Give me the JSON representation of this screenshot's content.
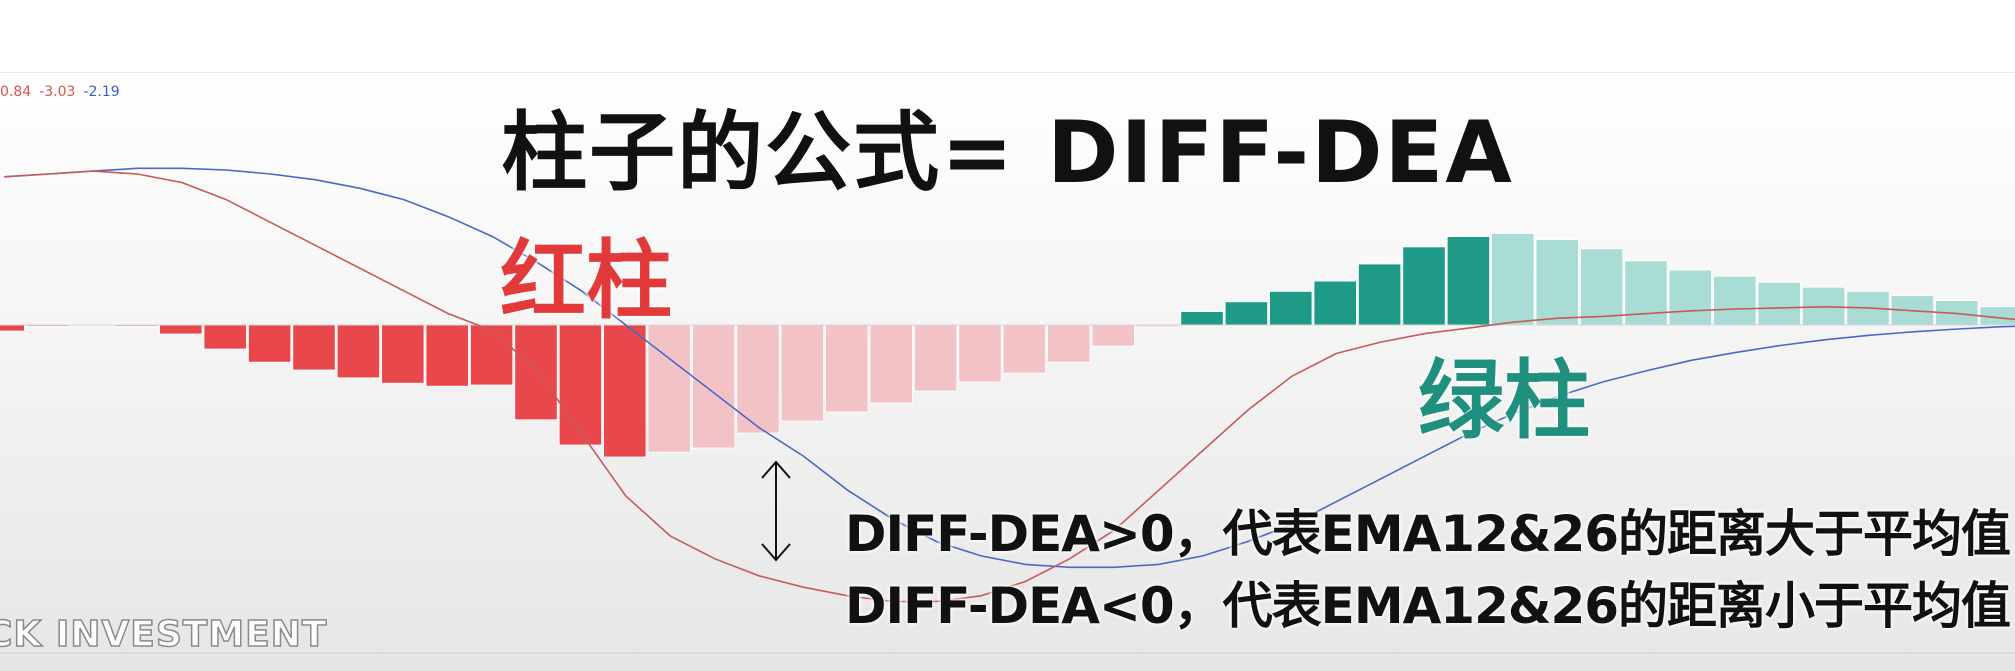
{
  "indicator_values": {
    "v1": "0.84",
    "v2": "-3.03",
    "v3": "-2.19"
  },
  "title": "柱子的公式= DIFF-DEA",
  "labels": {
    "red": "红柱",
    "green": "绿柱"
  },
  "explanations": {
    "positive": "DIFF-DEA>0，代表EMA12&26的距离大于平均值",
    "negative": "DIFF-DEA<0，代表EMA12&26的距离小于平均值"
  },
  "watermark": "CK INVESTMENT",
  "colors": {
    "red_solid": "#e8474b",
    "red_faded": "#f2c2c7",
    "green_solid": "#1e9a86",
    "green_faded": "#a9dcd4",
    "diff_line": "#c85a5a",
    "dea_line": "#4a68c8"
  },
  "chart_data": {
    "type": "bar",
    "ylim": [
      -2.2,
      1.6
    ],
    "histogram": [
      -0.1,
      -0.02,
      0,
      -0.02,
      -0.15,
      -0.4,
      -0.62,
      -0.75,
      -0.88,
      -0.97,
      -1.02,
      -1.0,
      -1.58,
      -2.0,
      -2.2,
      -2.12,
      -2.05,
      -1.8,
      -1.6,
      -1.45,
      -1.3,
      -1.1,
      -0.95,
      -0.8,
      -0.62,
      -0.35,
      -0.03,
      0.22,
      0.38,
      0.55,
      0.72,
      1.0,
      1.28,
      1.45,
      1.5,
      1.4,
      1.25,
      1.05,
      0.9,
      0.8,
      0.7,
      0.62,
      0.55,
      0.48,
      0.4,
      0.3,
      0.2,
      0.1
    ],
    "solid_red_end": 14,
    "solid_green_start": 26,
    "solid_green_end": 33,
    "diff": [
      2.6,
      2.65,
      2.7,
      2.65,
      2.5,
      2.2,
      1.8,
      1.4,
      1.0,
      0.6,
      0.2,
      -0.1,
      -0.8,
      -1.9,
      -3.0,
      -3.7,
      -4.1,
      -4.4,
      -4.6,
      -4.75,
      -4.85,
      -4.85,
      -4.75,
      -4.5,
      -4.1,
      -3.6,
      -2.9,
      -2.2,
      -1.5,
      -0.9,
      -0.5,
      -0.3,
      -0.15,
      -0.05,
      0.05,
      0.12,
      0.15,
      0.2,
      0.25,
      0.28,
      0.3,
      0.32,
      0.3,
      0.25,
      0.2,
      0.12,
      0.05,
      0.0
    ],
    "dea": [
      2.6,
      2.65,
      2.7,
      2.75,
      2.75,
      2.72,
      2.65,
      2.55,
      2.4,
      2.2,
      1.9,
      1.55,
      1.1,
      0.6,
      0.0,
      -0.6,
      -1.2,
      -1.8,
      -2.3,
      -2.9,
      -3.4,
      -3.8,
      -4.05,
      -4.2,
      -4.25,
      -4.25,
      -4.2,
      -4.05,
      -3.8,
      -3.5,
      -3.1,
      -2.7,
      -2.3,
      -1.9,
      -1.55,
      -1.25,
      -1.0,
      -0.8,
      -0.62,
      -0.48,
      -0.36,
      -0.26,
      -0.18,
      -0.12,
      -0.07,
      -0.03,
      -0.01,
      0.0
    ]
  }
}
